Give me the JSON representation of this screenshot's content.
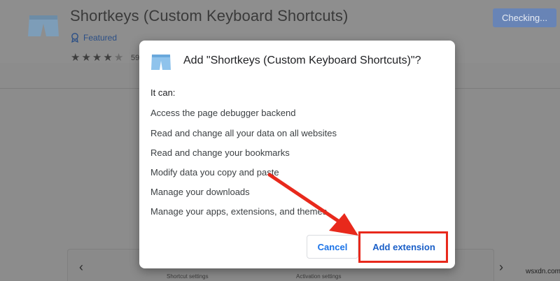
{
  "background": {
    "extension_title": "Shortkeys (Custom Keyboard Shortcuts)",
    "featured_label": "Featured",
    "stars": [
      "★",
      "★",
      "★",
      "★",
      "★"
    ],
    "rating_count": "59",
    "status_button": "Checking...",
    "gallery": {
      "caption_left": "Shortcut settings",
      "caption_right": "Activation settings",
      "prev_icon": "‹",
      "next_icon": "›"
    }
  },
  "dialog": {
    "title": "Add \"Shortkeys (Custom Keyboard Shortcuts)\"?",
    "intro": "It can:",
    "permissions": [
      "Access the page debugger backend",
      "Read and change all your data on all websites",
      "Read and change your bookmarks",
      "Modify data you copy and paste",
      "Manage your downloads",
      "Manage your apps, extensions, and themes"
    ],
    "cancel_label": "Cancel",
    "add_label": "Add extension",
    "icon": "shorts-icon"
  },
  "annotation": {
    "color": "#e8291c"
  },
  "watermark": "wsxdn.com"
}
